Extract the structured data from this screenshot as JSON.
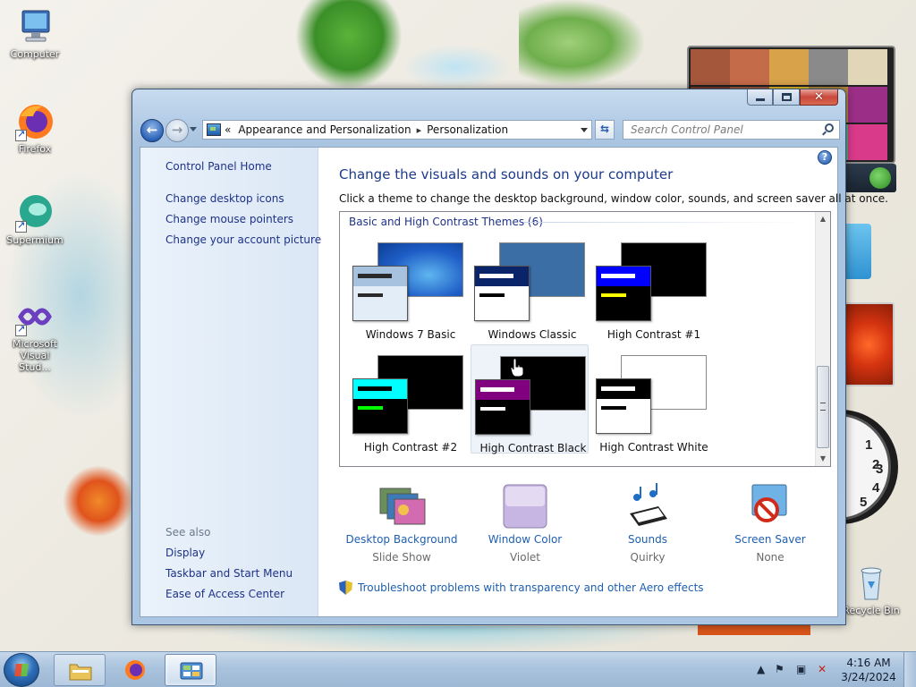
{
  "desktop": {
    "icons": [
      {
        "label": "Computer"
      },
      {
        "label": "Firefox"
      },
      {
        "label": "Supermium"
      },
      {
        "label": "Microsoft Visual Stud..."
      },
      {
        "label": "Recycle Bin"
      }
    ],
    "clock_gadget_numbers": [
      "1",
      "2",
      "3",
      "4",
      "5"
    ]
  },
  "window": {
    "breadcrumb": {
      "prefix": "«",
      "items": [
        "Appearance and Personalization",
        "Personalization"
      ],
      "separator": "▸"
    },
    "search": {
      "placeholder": "Search Control Panel"
    },
    "sidebar": {
      "home": "Control Panel Home",
      "links": [
        "Change desktop icons",
        "Change mouse pointers",
        "Change your account picture"
      ],
      "see_also_label": "See also",
      "see_also": [
        "Display",
        "Taskbar and Start Menu",
        "Ease of Access Center"
      ]
    },
    "main": {
      "title": "Change the visuals and sounds on your computer",
      "subtitle": "Click a theme to change the desktop background, window color, sounds, and screen saver all at once.",
      "group_header": "Basic and High Contrast Themes (6)",
      "themes": [
        {
          "name": "Windows 7 Basic",
          "bg_color": "#1f5ec7",
          "fg_color": "#e3edf7",
          "titlebar_color": "#a7c2de",
          "bar1_color": "#2a2a2a",
          "bar2_color": "#2a2a2a"
        },
        {
          "name": "Windows Classic",
          "bg_color": "#3a6ea5",
          "fg_color": "#ffffff",
          "titlebar_color": "#0a246a",
          "bar1_color": "#ffffff",
          "bar2_color": "#000000"
        },
        {
          "name": "High Contrast #1",
          "bg_color": "#000000",
          "fg_color": "#000000",
          "titlebar_color": "#0000ff",
          "bar1_color": "#ffffff",
          "bar2_color": "#ffff00"
        },
        {
          "name": "High Contrast #2",
          "bg_color": "#000000",
          "fg_color": "#000000",
          "titlebar_color": "#00ffff",
          "bar1_color": "#000000",
          "bar2_color": "#00ff00"
        },
        {
          "name": "High Contrast Black",
          "bg_color": "#000000",
          "fg_color": "#000000",
          "titlebar_color": "#800080",
          "bar1_color": "#ffffff",
          "bar2_color": "#ffffff",
          "selected": true
        },
        {
          "name": "High Contrast White",
          "bg_color": "#ffffff",
          "fg_color": "#ffffff",
          "titlebar_color": "#000000",
          "bar1_color": "#ffffff",
          "bar2_color": "#000000"
        }
      ],
      "tiles": [
        {
          "title": "Desktop Background",
          "value": "Slide Show",
          "icon": "desktop-background-icon"
        },
        {
          "title": "Window Color",
          "value": "Violet",
          "icon": "window-color-icon"
        },
        {
          "title": "Sounds",
          "value": "Quirky",
          "icon": "sounds-icon"
        },
        {
          "title": "Screen Saver",
          "value": "None",
          "icon": "screen-saver-icon"
        }
      ],
      "troubleshoot_link": "Troubleshoot problems with transparency and other Aero effects"
    }
  },
  "taskbar": {
    "time": "4:16 AM",
    "date": "3/24/2024"
  },
  "colors": {
    "link": "#1e3287",
    "title_blue": "#1d3a8a",
    "tile_link": "#1e5fb0",
    "window_frame": "#aac6e2"
  }
}
